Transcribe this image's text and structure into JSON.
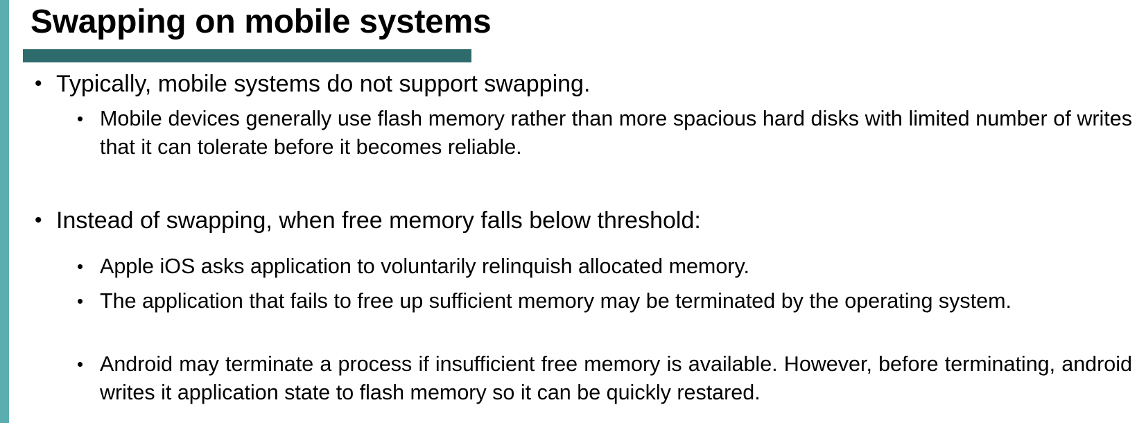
{
  "slide": {
    "title": "Swapping on mobile systems",
    "bullet_glyph": "•",
    "bullets": [
      {
        "text": "Typically, mobile systems do not support swapping.",
        "sub": [
          "Mobile devices generally use flash memory rather than more spacious hard disks with limited number of writes that it can tolerate before it becomes reliable."
        ]
      },
      {
        "text": "Instead of swapping, when free memory falls below threshold:",
        "sub": [
          "Apple iOS asks application to voluntarily relinquish allocated memory.",
          "The application that fails to free up sufficient memory may be terminated by the operating system.",
          "Android may terminate a process if insufficient free memory is available. However, before terminating, android writes it application state to flash memory so it can be quickly restared."
        ]
      }
    ]
  },
  "colors": {
    "left_accent": "#5aaeb0",
    "title_underline": "#2e6b6c",
    "text": "#000000",
    "background": "#ffffff"
  }
}
